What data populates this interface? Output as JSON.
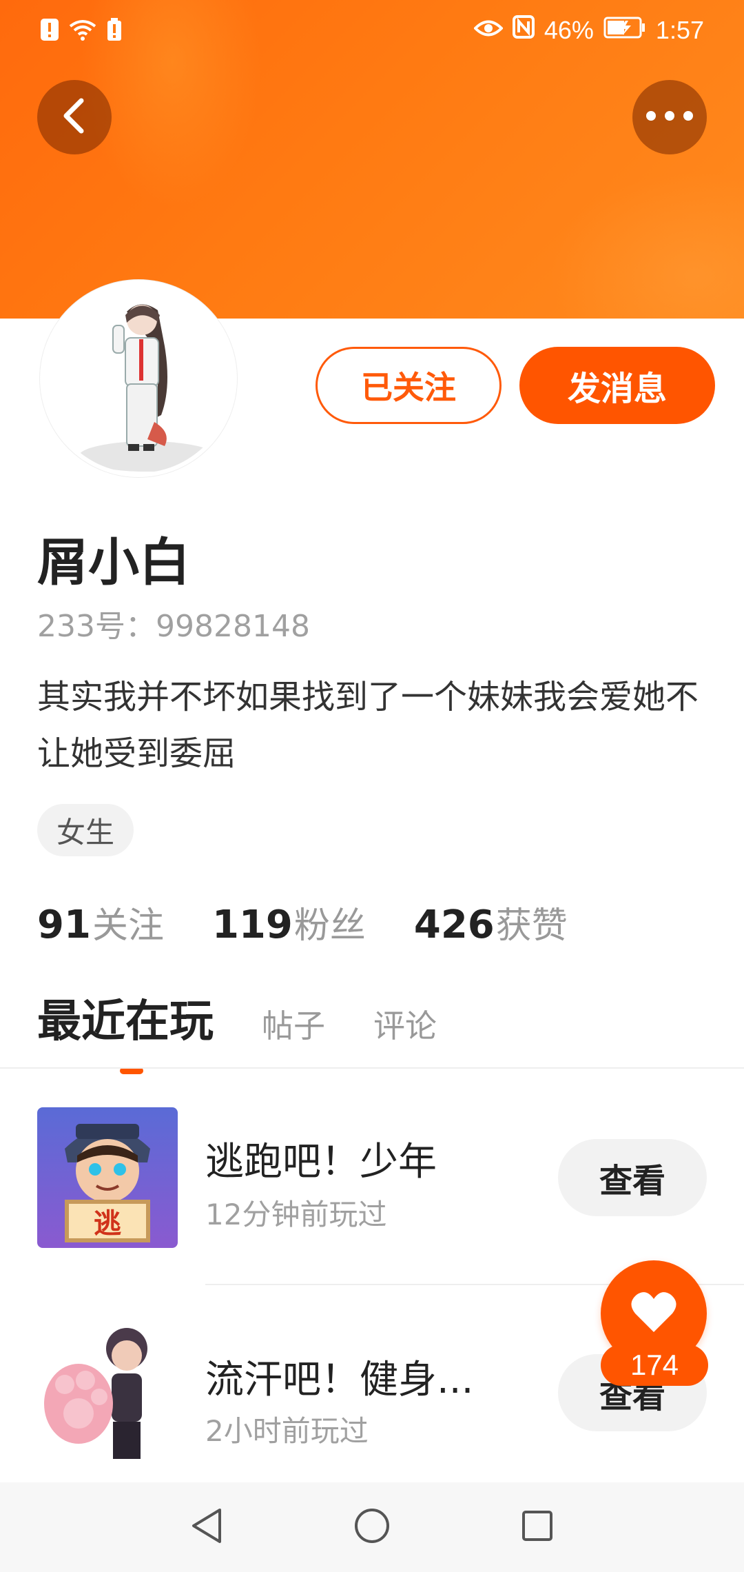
{
  "status_bar": {
    "battery_percent": "46%",
    "time": "1:57"
  },
  "profile": {
    "username": "屑小白",
    "uid_label": "233号：",
    "uid": "99828148",
    "bio": "其实我并不坏如果找到了一个妹妹我会爱她不让她受到委屈",
    "gender_tag": "女生",
    "follow_button": "已关注",
    "message_button": "发消息"
  },
  "stats": [
    {
      "value": "91",
      "label": "关注"
    },
    {
      "value": "119",
      "label": "粉丝"
    },
    {
      "value": "426",
      "label": "获赞"
    }
  ],
  "tabs": [
    {
      "label": "最近在玩",
      "active": true
    },
    {
      "label": "帖子",
      "active": false
    },
    {
      "label": "评论",
      "active": false
    }
  ],
  "games": [
    {
      "title": "逃跑吧！少年",
      "subtitle": "12分钟前玩过",
      "button": "查看",
      "icon_badge": "逃"
    },
    {
      "title": "流汗吧！健身...",
      "subtitle": "2小时前玩过",
      "button": "查看"
    }
  ],
  "like_float": {
    "count": "174"
  },
  "colors": {
    "accent": "#ff5500",
    "banner": "#ff7a12"
  }
}
